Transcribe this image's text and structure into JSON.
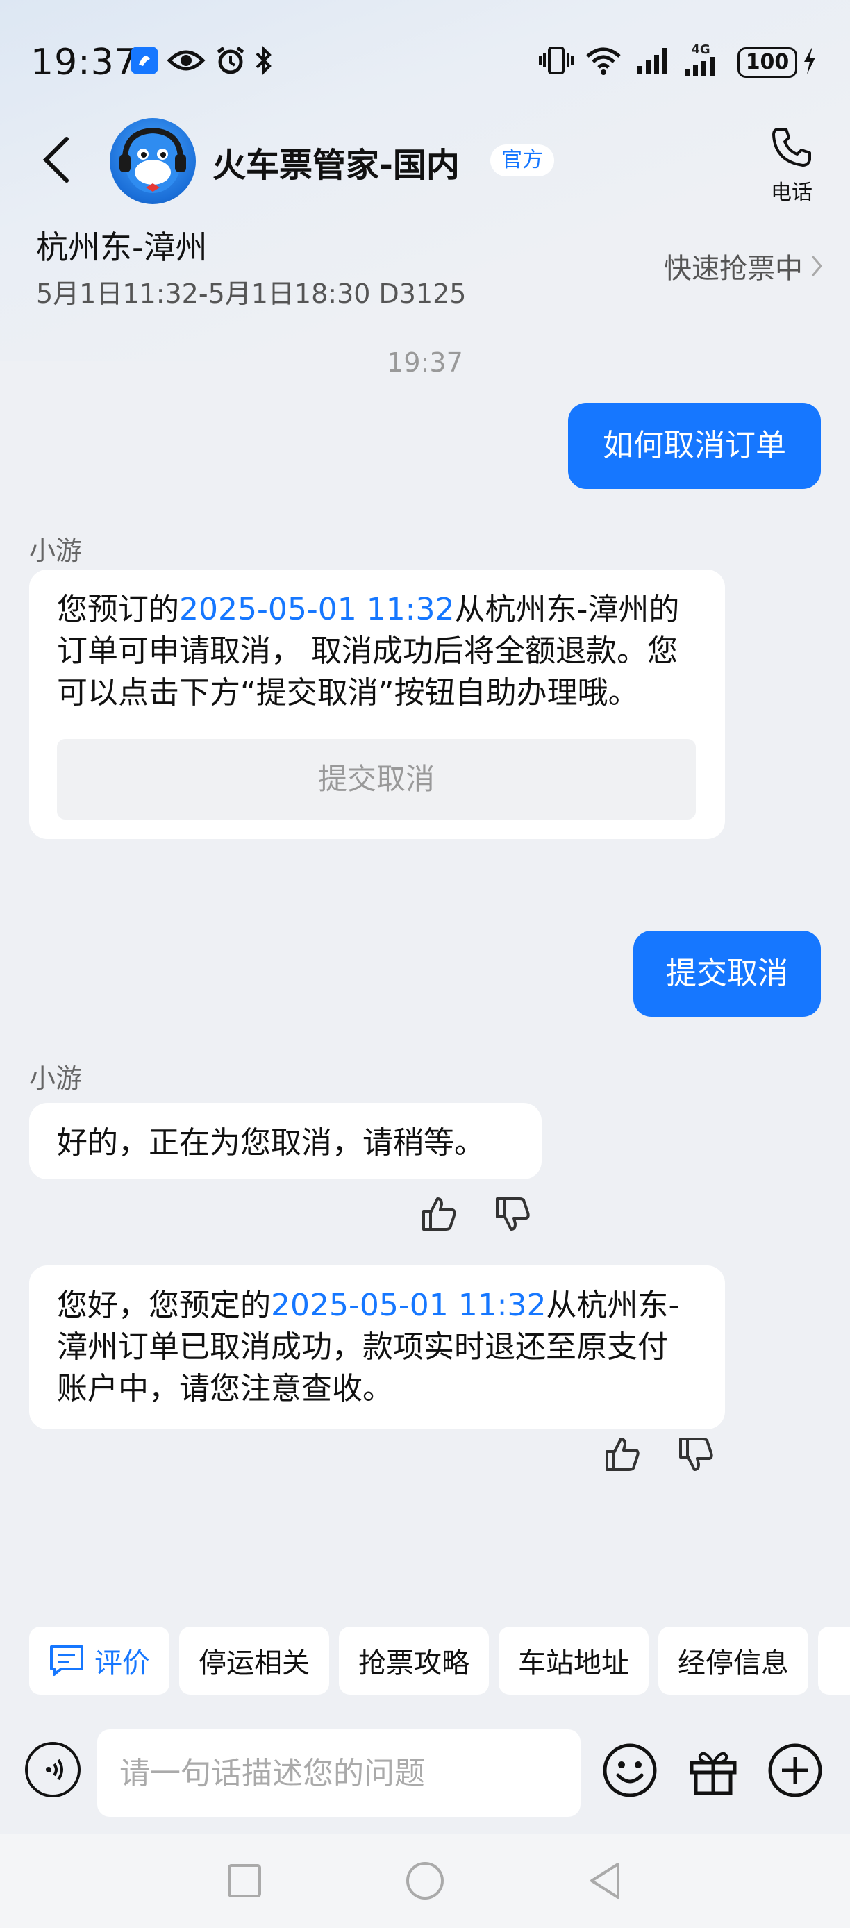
{
  "status_bar": {
    "time": "19:37",
    "battery": "100",
    "network": "4G",
    "icons": [
      "app-notify-icon",
      "eye-icon",
      "alarm-icon",
      "bluetooth-icon",
      "vibrate-icon",
      "wifi-icon",
      "signal-icon",
      "signal-4g-icon",
      "charging-icon"
    ]
  },
  "header": {
    "title": "火车票管家-国内",
    "badge": "官方",
    "phone_label": "电话"
  },
  "trip": {
    "route": "杭州东-漳州",
    "detail": "5月1日11:32-5月1日18:30 D3125",
    "status": "快速抢票中"
  },
  "chat": {
    "timestamp": "19:37",
    "user_msg_1": "如何取消订单",
    "bot_name": "小游",
    "bot_msg_1": {
      "prefix": "您预订的",
      "highlight": "2025-05-01 11:32",
      "suffix": "从杭州东-漳州的订单可申请取消， 取消成功后将全额退款。您可以点击下方“提交取消”按钮自助办理哦。",
      "button": "提交取消"
    },
    "user_msg_2": "提交取消",
    "bot_name_2": "小游",
    "bot_msg_2": "好的，正在为您取消，请稍等。",
    "bot_msg_3": {
      "prefix": "您好，您预定的",
      "highlight": "2025-05-01 11:32",
      "suffix": "从杭州东-漳州订单已取消成功，款项实时退还至原支付账户中，请您注意查收。"
    }
  },
  "quick_replies": [
    "评价",
    "停运相关",
    "抢票攻略",
    "车站地址",
    "经停信息"
  ],
  "input": {
    "placeholder": "请一句话描述您的问题"
  },
  "colors": {
    "accent": "#1677ff",
    "background": "#eef0f4",
    "bubble_bot": "#ffffff"
  }
}
